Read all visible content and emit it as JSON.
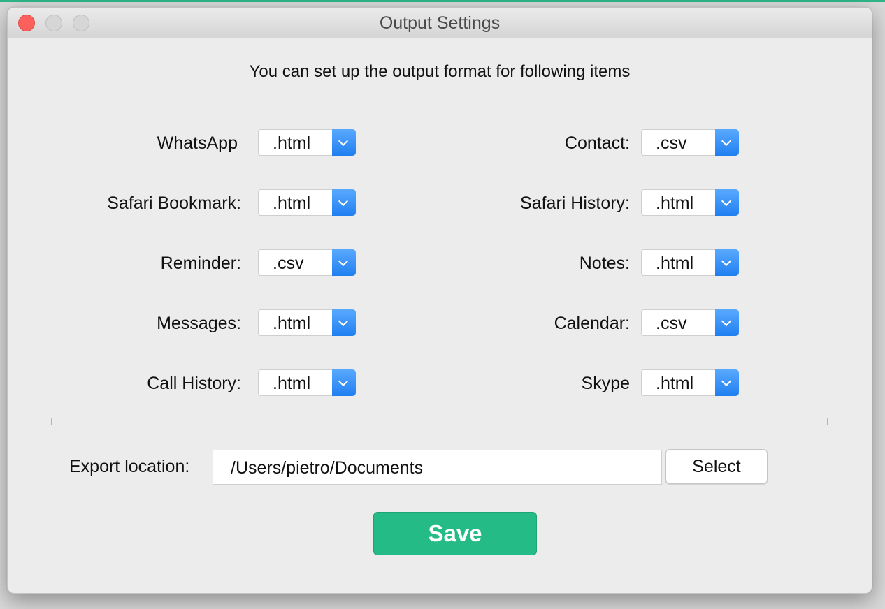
{
  "window": {
    "title": "Output Settings"
  },
  "intro_text": "You can set up the output format for following items",
  "left_items": [
    {
      "label": "WhatsApp",
      "value": ".html"
    },
    {
      "label": "Safari Bookmark:",
      "value": ".html"
    },
    {
      "label": "Reminder:",
      "value": ".csv"
    },
    {
      "label": "Messages:",
      "value": ".html"
    },
    {
      "label": "Call History:",
      "value": ".html"
    }
  ],
  "right_items": [
    {
      "label": "Contact:",
      "value": ".csv"
    },
    {
      "label": "Safari History:",
      "value": ".html"
    },
    {
      "label": "Notes:",
      "value": ".html"
    },
    {
      "label": "Calendar:",
      "value": ".csv"
    },
    {
      "label": "Skype",
      "value": ".html"
    }
  ],
  "export": {
    "label": "Export location:",
    "path": "/Users/pietro/Documents",
    "select_label": "Select"
  },
  "save_label": "Save",
  "colors": {
    "accent": "#25bb87",
    "dropdown": "#1f7ff0",
    "close": "#fc605c"
  }
}
